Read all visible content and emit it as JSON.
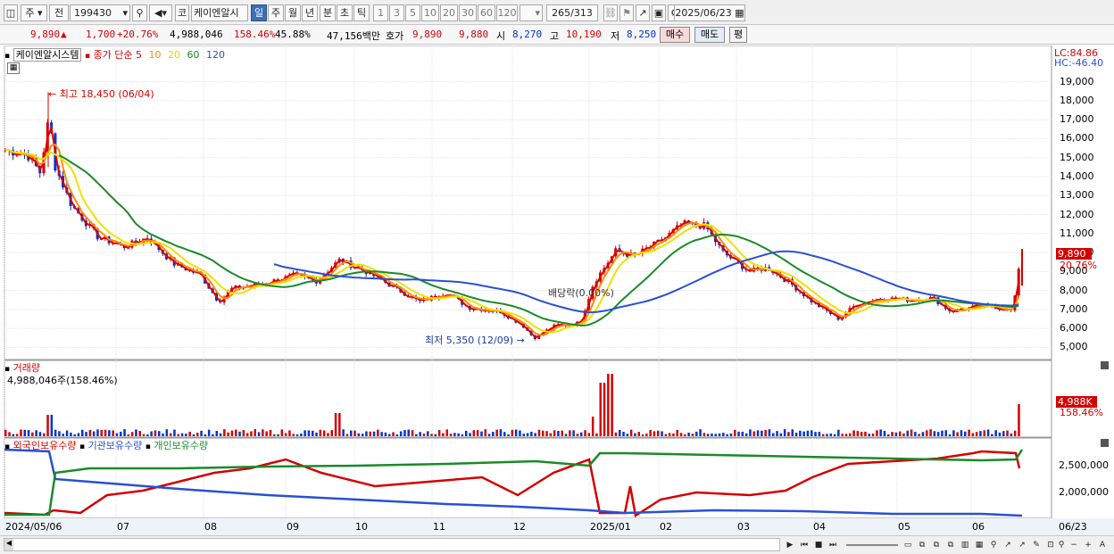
{
  "toolbar": {
    "market": "주",
    "prev": "전",
    "code": "199430",
    "search_icon": "magnifier-icon",
    "sound_icon": "speaker-icon",
    "type_btn": "코",
    "name": "케이엔알시",
    "periods": [
      "일",
      "주",
      "월",
      "년",
      "분",
      "초",
      "틱"
    ],
    "intervals": [
      "1",
      "3",
      "5",
      "10",
      "20",
      "30",
      "60",
      "120"
    ],
    "count": "265",
    "total": "/313",
    "date": "2025/06/23"
  },
  "pricebar": {
    "price": "9,890",
    "arrow": "▲",
    "change": "1,700",
    "pct": "+20.76%",
    "volume": "4,988,046",
    "vol_ratio": "158.46%",
    "turnover": "45.88%",
    "amount": "47,156백만",
    "bid_label": "호가",
    "ask": "9,890",
    "bid": "9,880",
    "open_label": "시",
    "open": "8,270",
    "high_label": "고",
    "high": "10,190",
    "low_label": "저",
    "low": "8,250",
    "buy_btn": "매수",
    "sell_btn": "매도",
    "eval_btn": "평"
  },
  "legend": {
    "name": "케이엔알시스템",
    "ma_label": "종가 단순",
    "ma_periods": [
      "5",
      "10",
      "20",
      "60",
      "120"
    ],
    "ma_colors": [
      "#e00000",
      "#ff8c00",
      "#e8d400",
      "#1a8a2a",
      "#2a4fd6"
    ]
  },
  "lc": "LC:84.86",
  "hc": "HC:-46.40",
  "price_axis": [
    "19,000",
    "18,000",
    "17,000",
    "16,000",
    "15,000",
    "14,000",
    "13,000",
    "12,000",
    "11,000",
    "10,000",
    "9,000",
    "8,000",
    "7,000",
    "6,000",
    "5,000"
  ],
  "price_tag": "9,890",
  "pct_tag": "20.76%",
  "high_marker": "최고 18,450 (06/04)",
  "low_marker": "최저 5,350 (12/09)",
  "dividend_marker": "배당락(0.00%)",
  "volume": {
    "title": "거래량",
    "value": "4,988,046주(158.46%)",
    "tag": "4,988K",
    "tag_pct": "158.46%"
  },
  "holdings": {
    "legend": [
      "외국인보유수량",
      "기관보유수량",
      "개인보유수량"
    ],
    "colors": [
      "#d40000",
      "#2a4fd6",
      "#1a8a2a"
    ],
    "axis": [
      "2,500,000",
      "2,000,000"
    ]
  },
  "x_axis": [
    "2024/05/06",
    "07",
    "08",
    "09",
    "10",
    "11",
    "12",
    "2025/01",
    "02",
    "03",
    "04",
    "05",
    "06"
  ],
  "x_axis_right": "06/23",
  "chart_data": {
    "type": "candlestick",
    "title": "케이엔알시스템",
    "x": [
      "2024/05",
      "2024/06",
      "2024/07",
      "2024/08",
      "2024/09",
      "2024/10",
      "2024/11",
      "2024/12",
      "2025/01",
      "2025/02",
      "2025/03",
      "2025/04",
      "2025/05",
      "2025/06"
    ],
    "close_approx": [
      15500,
      15000,
      10500,
      8300,
      8600,
      9000,
      7400,
      5600,
      10300,
      11300,
      8600,
      6800,
      7600,
      9890
    ],
    "y_range": [
      4500,
      19500
    ],
    "high": 18450,
    "high_date": "06/04",
    "low": 5350,
    "low_date": "12/09",
    "moving_averages": [
      "5",
      "10",
      "20",
      "60",
      "120"
    ]
  }
}
